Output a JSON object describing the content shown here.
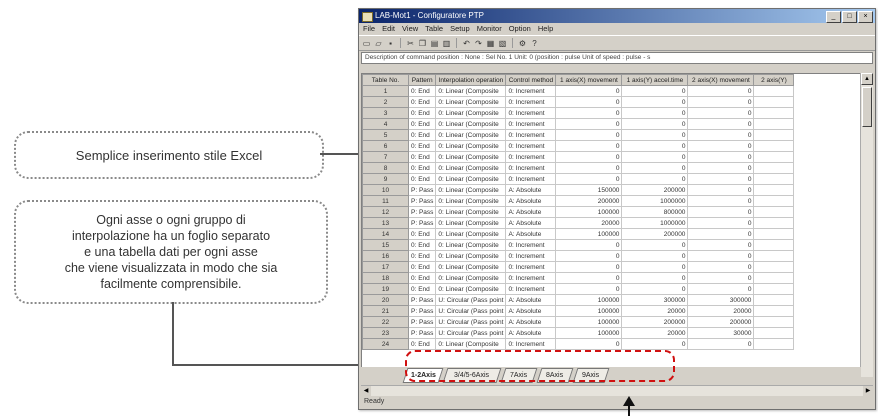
{
  "callouts": {
    "excel_style": "Semplice inserimento stile Excel",
    "axis_sheet": "Ogni asse o ogni gruppo di\ninterpolazione ha un foglio separato\ne una tabella dati per ogni asse\nche viene visualizzata in modo che sia\nfacilmente comprensibile."
  },
  "window": {
    "title": "LAB-Mot1 - Configuratore PTP",
    "menu": [
      "File",
      "Edit",
      "View",
      "Table",
      "Setup",
      "Monitor",
      "Option",
      "Help"
    ],
    "description": "Description of command position : None : Sel No. 1 Unit: 0 (position : pulse Unit of speed : pulse - s",
    "status": "Ready"
  },
  "table": {
    "headers": [
      "Table No.",
      "Pattern",
      "Interpolation operation",
      "Control method",
      "1 axis(X) movement",
      "1 axis(Y) accel.time",
      "2 axis(X) movement",
      "2 axis(Y)"
    ],
    "rows": [
      [
        "1",
        "0: End",
        "0: Linear (Composite",
        "0: Increment",
        "0",
        "0",
        "0",
        ""
      ],
      [
        "2",
        "0: End",
        "0: Linear (Composite",
        "0: Increment",
        "0",
        "0",
        "0",
        ""
      ],
      [
        "3",
        "0: End",
        "0: Linear (Composite",
        "0: Increment",
        "0",
        "0",
        "0",
        ""
      ],
      [
        "4",
        "0: End",
        "0: Linear (Composite",
        "0: Increment",
        "0",
        "0",
        "0",
        ""
      ],
      [
        "5",
        "0: End",
        "0: Linear (Composite",
        "0: Increment",
        "0",
        "0",
        "0",
        ""
      ],
      [
        "6",
        "0: End",
        "0: Linear (Composite",
        "0: Increment",
        "0",
        "0",
        "0",
        ""
      ],
      [
        "7",
        "0: End",
        "0: Linear (Composite",
        "0: Increment",
        "0",
        "0",
        "0",
        ""
      ],
      [
        "8",
        "0: End",
        "0: Linear (Composite",
        "0: Increment",
        "0",
        "0",
        "0",
        ""
      ],
      [
        "9",
        "0: End",
        "0: Linear (Composite",
        "0: Increment",
        "0",
        "0",
        "0",
        ""
      ],
      [
        "10",
        "P: Pass",
        "0: Linear (Composite",
        "A: Absolute",
        "150000",
        "200000",
        "0",
        ""
      ],
      [
        "11",
        "P: Pass",
        "0: Linear (Composite",
        "A: Absolute",
        "200000",
        "1000000",
        "0",
        ""
      ],
      [
        "12",
        "P: Pass",
        "0: Linear (Composite",
        "A: Absolute",
        "100000",
        "800000",
        "0",
        ""
      ],
      [
        "13",
        "P: Pass",
        "0: Linear (Composite",
        "A: Absolute",
        "20000",
        "1000000",
        "0",
        ""
      ],
      [
        "14",
        "0: End",
        "0: Linear (Composite",
        "A: Absolute",
        "100000",
        "200000",
        "0",
        ""
      ],
      [
        "15",
        "0: End",
        "0: Linear (Composite",
        "0: Increment",
        "0",
        "0",
        "0",
        ""
      ],
      [
        "16",
        "0: End",
        "0: Linear (Composite",
        "0: Increment",
        "0",
        "0",
        "0",
        ""
      ],
      [
        "17",
        "0: End",
        "0: Linear (Composite",
        "0: Increment",
        "0",
        "0",
        "0",
        ""
      ],
      [
        "18",
        "0: End",
        "0: Linear (Composite",
        "0: Increment",
        "0",
        "0",
        "0",
        ""
      ],
      [
        "19",
        "0: End",
        "0: Linear (Composite",
        "0: Increment",
        "0",
        "0",
        "0",
        ""
      ],
      [
        "20",
        "P: Pass",
        "U: Circular (Pass point",
        "A: Absolute",
        "100000",
        "300000",
        "300000",
        ""
      ],
      [
        "21",
        "P: Pass",
        "U: Circular (Pass point",
        "A: Absolute",
        "100000",
        "20000",
        "20000",
        ""
      ],
      [
        "22",
        "P: Pass",
        "U: Circular (Pass point",
        "A: Absolute",
        "100000",
        "200000",
        "200000",
        ""
      ],
      [
        "23",
        "P: Pass",
        "U: Circular (Pass point",
        "A: Absolute",
        "100000",
        "20000",
        "30000",
        ""
      ],
      [
        "24",
        "0: End",
        "0: Linear (Composite",
        "0: Increment",
        "0",
        "0",
        "0",
        ""
      ]
    ]
  },
  "tabs": [
    "1-2Axis",
    "3/4/5-6Axis",
    "7Axis",
    "8Axis",
    "9Axis"
  ]
}
